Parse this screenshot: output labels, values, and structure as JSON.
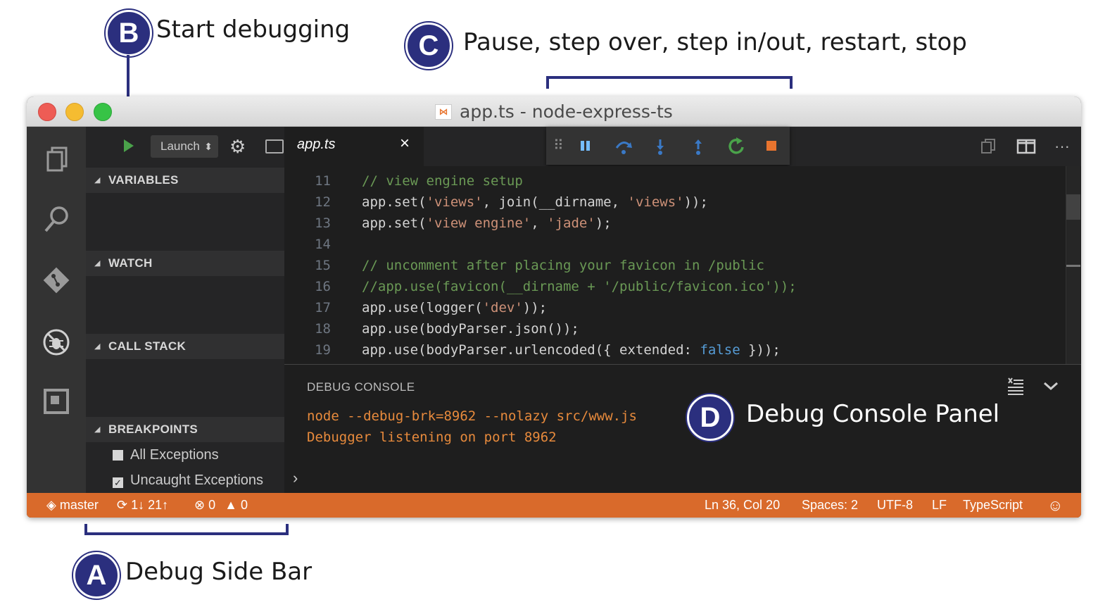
{
  "annotations": {
    "a": {
      "letter": "A",
      "text": "Debug Side Bar"
    },
    "b": {
      "letter": "B",
      "text": "Start debugging"
    },
    "c": {
      "letter": "C",
      "text": "Pause, step over, step in/out, restart, stop"
    },
    "d": {
      "letter": "D",
      "text": "Debug Console Panel"
    },
    "color": "#2b2f7e"
  },
  "window": {
    "title": "app.ts - node-express-ts",
    "title_icon": "vscode-file-icon",
    "traffic_lights": [
      "#ee5c55",
      "#f5bc31",
      "#37c346"
    ]
  },
  "activity_bar": {
    "icons": [
      "files-icon",
      "search-icon",
      "git-icon",
      "debug-icon",
      "extensions-icon"
    ]
  },
  "debug_toolbar": {
    "start_icon": "play-icon",
    "config": "Launch",
    "gear_icon": "gear-icon",
    "console_icon": "terminal-icon"
  },
  "sidebar": {
    "sections": [
      {
        "label": "VARIABLES"
      },
      {
        "label": "WATCH"
      },
      {
        "label": "CALL STACK"
      },
      {
        "label": "BREAKPOINTS"
      }
    ],
    "breakpoints": [
      {
        "label": "All Exceptions",
        "checked": false
      },
      {
        "label": "Uncaught Exceptions",
        "checked": true
      }
    ]
  },
  "tab": {
    "label": "app.ts",
    "close": "×"
  },
  "floating_toolbar": {
    "icons": [
      "drag-handle-icon",
      "pause-icon",
      "step-over-icon",
      "step-into-icon",
      "step-out-icon",
      "restart-icon",
      "stop-icon"
    ]
  },
  "editor_actions": [
    "split-view-icon",
    "split-editor-icon",
    "more-icon"
  ],
  "editor": {
    "lines": [
      {
        "n": "11",
        "parts": [
          {
            "t": "// view engine setup",
            "c": "comment"
          }
        ]
      },
      {
        "n": "12",
        "parts": [
          {
            "t": "app.set(",
            "c": ""
          },
          {
            "t": "'views'",
            "c": "str"
          },
          {
            "t": ", join(__dirname, ",
            "c": ""
          },
          {
            "t": "'views'",
            "c": "str"
          },
          {
            "t": "));",
            "c": ""
          }
        ]
      },
      {
        "n": "13",
        "parts": [
          {
            "t": "app.set(",
            "c": ""
          },
          {
            "t": "'view engine'",
            "c": "str"
          },
          {
            "t": ", ",
            "c": ""
          },
          {
            "t": "'jade'",
            "c": "str"
          },
          {
            "t": ");",
            "c": ""
          }
        ]
      },
      {
        "n": "14",
        "parts": []
      },
      {
        "n": "15",
        "parts": [
          {
            "t": "// uncomment after placing your favicon in /public",
            "c": "comment"
          }
        ]
      },
      {
        "n": "16",
        "parts": [
          {
            "t": "//app.use(favicon(__dirname + '/public/favicon.ico'));",
            "c": "comment"
          }
        ]
      },
      {
        "n": "17",
        "parts": [
          {
            "t": "app.use(logger(",
            "c": ""
          },
          {
            "t": "'dev'",
            "c": "str"
          },
          {
            "t": "));",
            "c": ""
          }
        ]
      },
      {
        "n": "18",
        "parts": [
          {
            "t": "app.use(bodyParser.json());",
            "c": ""
          }
        ]
      },
      {
        "n": "19",
        "parts": [
          {
            "t": "app.use(bodyParser.urlencoded({ extended: ",
            "c": ""
          },
          {
            "t": "false",
            "c": "kw"
          },
          {
            "t": " }));",
            "c": ""
          }
        ]
      }
    ]
  },
  "debug_console": {
    "title": "DEBUG CONSOLE",
    "lines": [
      "node --debug-brk=8962 --nolazy src/www.js",
      "Debugger listening on port 8962"
    ],
    "prompt": "›",
    "icons": [
      "clear-console-icon",
      "chevron-down-icon"
    ]
  },
  "status_bar": {
    "branch": "master",
    "sync": "1↓ 21↑",
    "errors": "0",
    "warnings": "0",
    "position": "Ln 36, Col 20",
    "spaces": "Spaces: 2",
    "encoding": "UTF-8",
    "eol": "LF",
    "language": "TypeScript",
    "color": "#d96a2b"
  }
}
